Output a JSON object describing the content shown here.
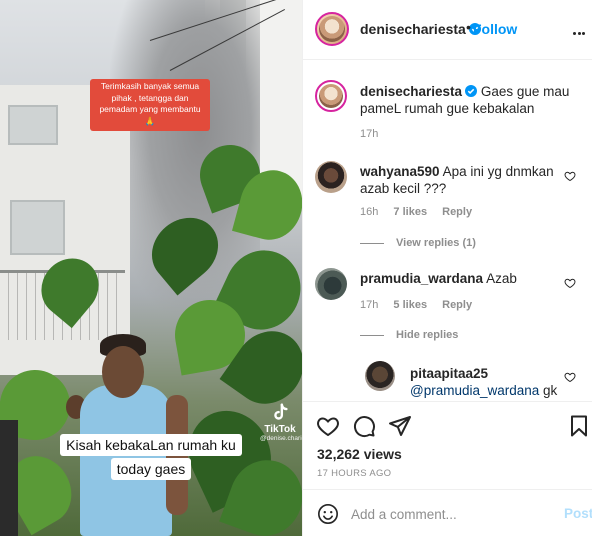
{
  "media": {
    "overlay_text": "Terimkasih  banyak semua pihak , tetangga dan pemadam yang membantu 🙏",
    "caption_lines": [
      "Kisah kebakaLan rumah ku",
      "today gaes"
    ],
    "tiktok_label": "TikTok",
    "tiktok_user": "@denise.chariesta"
  },
  "header": {
    "username": "denisechariesta",
    "separator": "•",
    "follow_label": "Follow"
  },
  "caption": {
    "username": "denisechariesta",
    "text": "Gaes gue mau pameL rumah gue kebakalan",
    "time": "17h"
  },
  "comments": [
    {
      "username": "wahyana590",
      "text": "Apa ini yg dnmkan azab kecil ???",
      "time": "16h",
      "likes": "7 likes",
      "reply_label": "Reply",
      "replies_toggle": "View replies (1)"
    },
    {
      "username": "pramudia_wardana",
      "text": "Azab",
      "time": "17h",
      "likes": "5 likes",
      "reply_label": "Reply",
      "replies_toggle": "Hide replies"
    }
  ],
  "reply": {
    "username": "pitaapitaa25",
    "mention": "@pramudia_wardana",
    "text": " gk"
  },
  "actions": {
    "views": "32,262 views",
    "time_ago": "17 HOURS AGO"
  },
  "add_comment": {
    "placeholder": "Add a comment...",
    "post_label": "Post"
  },
  "colors": {
    "link_blue": "#0095f6",
    "post_disabled": "#b2dffc",
    "muted": "#8e8e8e",
    "overlay_red": "#e24b3b"
  },
  "icons": [
    "verified-badge-icon",
    "more-options-icon",
    "heart-icon",
    "comment-icon",
    "share-icon",
    "bookmark-icon",
    "emoji-icon",
    "tiktok-logo-icon"
  ]
}
